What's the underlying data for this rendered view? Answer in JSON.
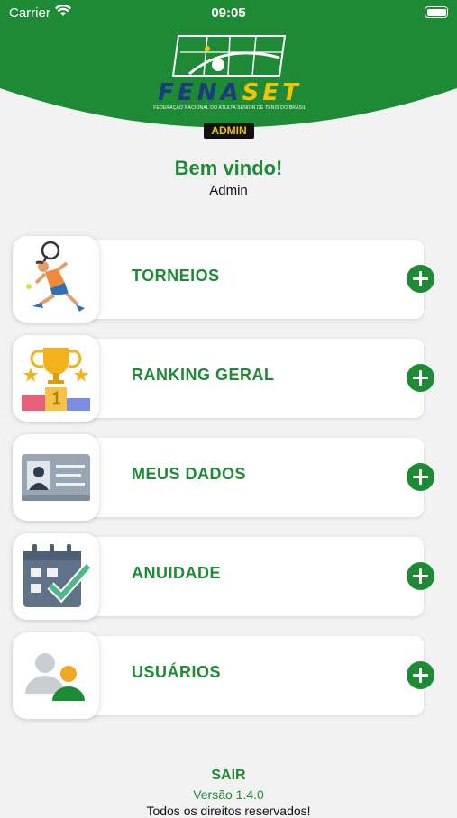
{
  "status_bar": {
    "carrier": "Carrier",
    "time": "09:05"
  },
  "header": {
    "logo_text_part1": "FENA",
    "logo_text_part2": "SET",
    "logo_subtitle": "FEDERAÇÃO NACIONAL DO ATLETA SÊNIOR DE TÊNIS DO BRASIL",
    "role_badge": "ADMIN",
    "brand_green": "#1e8a36",
    "brand_yellow": "#f4c300"
  },
  "welcome": {
    "title": "Bem vindo!",
    "user": "Admin"
  },
  "menu": [
    {
      "label": "TORNEIOS",
      "icon": "tennis-player-icon"
    },
    {
      "label": "RANKING GERAL",
      "icon": "trophy-podium-icon"
    },
    {
      "label": "MEUS DADOS",
      "icon": "id-card-icon"
    },
    {
      "label": "ANUIDADE",
      "icon": "calendar-check-icon"
    },
    {
      "label": "USUÁRIOS",
      "icon": "users-icon"
    }
  ],
  "footer": {
    "logout": "SAIR",
    "version": "Versão 1.4.0",
    "copyright": "Todos os direitos reservados!"
  }
}
